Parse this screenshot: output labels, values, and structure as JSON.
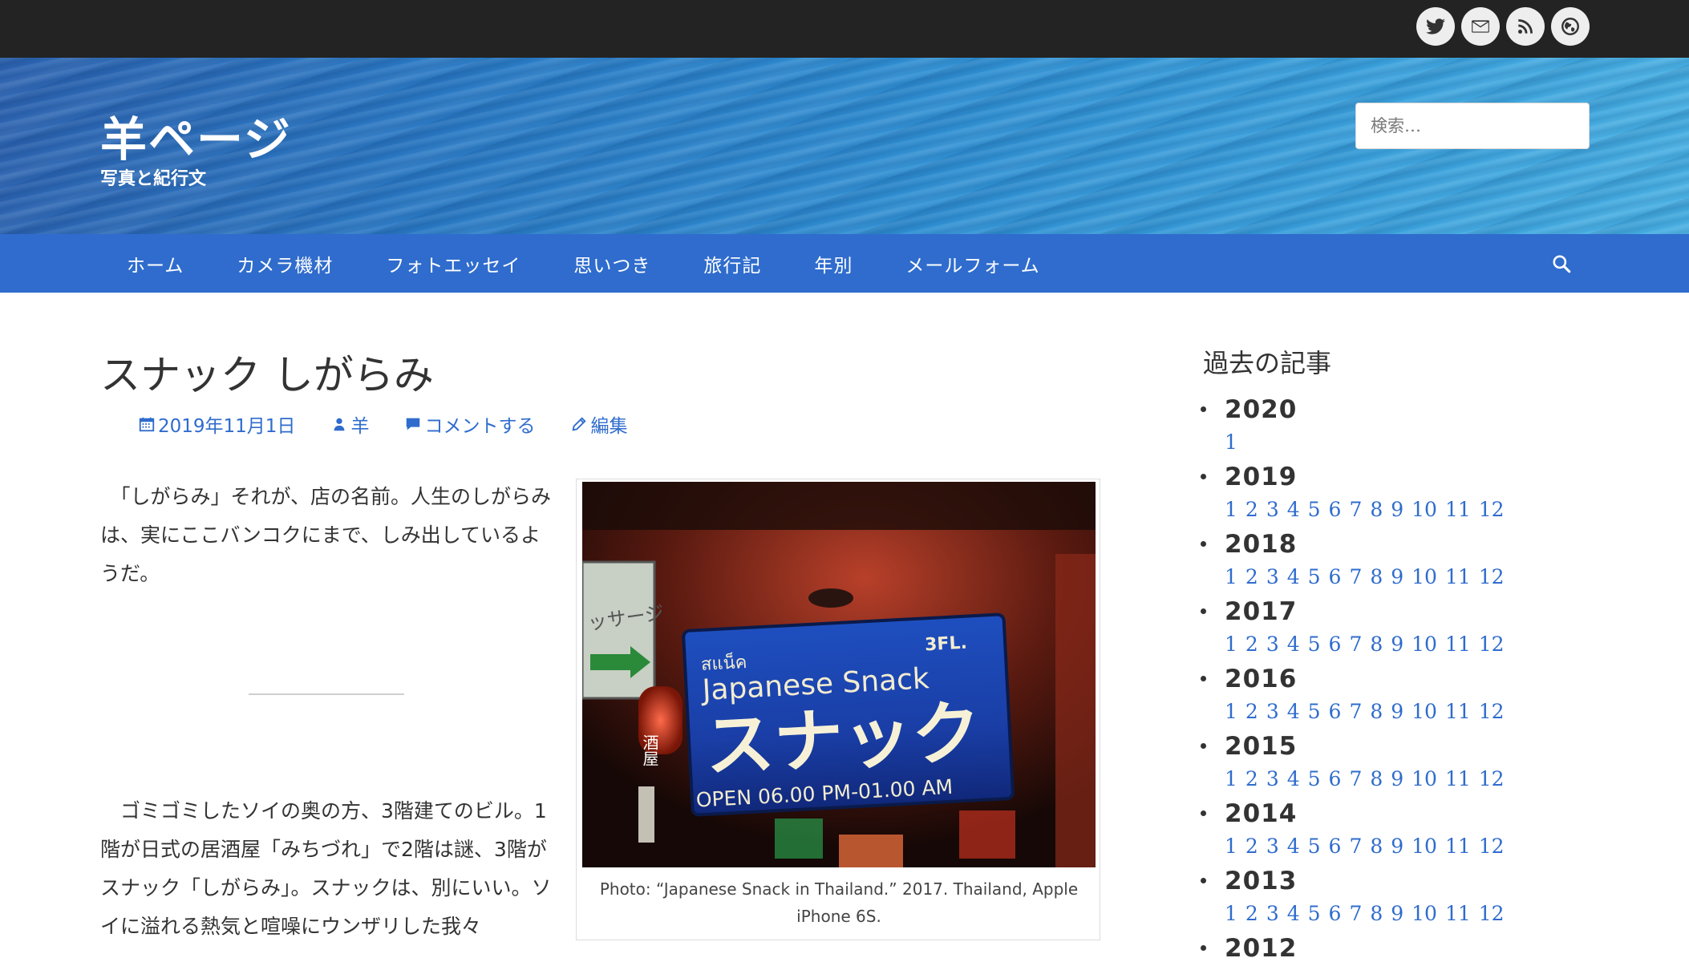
{
  "topbar": {
    "social": [
      {
        "icon": "twitter-icon"
      },
      {
        "icon": "mail-icon"
      },
      {
        "icon": "rss-icon"
      },
      {
        "icon": "globe-icon"
      }
    ]
  },
  "header": {
    "title": "羊ページ",
    "tagline": "写真と紀行文",
    "search_placeholder": "検索…"
  },
  "nav": {
    "items": [
      "ホーム",
      "カメラ機材",
      "フォトエッセイ",
      "思いつき",
      "旅行記",
      "年別",
      "メールフォーム"
    ]
  },
  "post": {
    "title": "スナック しがらみ",
    "date": "2019年11月1日",
    "author": "羊",
    "comment": "コメントする",
    "edit": "編集",
    "paragraph1": "　「しがらみ」それが、店の名前。人生のしがらみは、実にここバンコクにまで、しみ出しているようだ。",
    "paragraph2": "　ゴミゴミしたソイの奥の方、3階建てのビル。1階が日式の居酒屋「みちづれ」で2階は謎、3階がスナック「しがらみ」。スナックは、別にいい。ソイに溢れる熱気と喧噪にウンザリした我々",
    "caption": "Photo: “Japanese Snack in Thailand.” 2017. Thailand, Apple iPhone 6S.",
    "sign": {
      "floor": "3FL.",
      "thai": "สแน็ค",
      "english": "Japanese Snack",
      "katakana": "スナック",
      "hours": "OPEN 06.00 PM-01.00 AM",
      "left_sign": "ッサージ",
      "lantern": "酒屋"
    }
  },
  "sidebar": {
    "title": "過去の記事",
    "archives": [
      {
        "year": "2020",
        "months": [
          "1"
        ]
      },
      {
        "year": "2019",
        "months": [
          "1",
          "2",
          "3",
          "4",
          "5",
          "6",
          "7",
          "8",
          "9",
          "10",
          "11",
          "12"
        ]
      },
      {
        "year": "2018",
        "months": [
          "1",
          "2",
          "3",
          "4",
          "5",
          "6",
          "7",
          "8",
          "9",
          "10",
          "11",
          "12"
        ]
      },
      {
        "year": "2017",
        "months": [
          "1",
          "2",
          "3",
          "4",
          "5",
          "6",
          "7",
          "8",
          "9",
          "10",
          "11",
          "12"
        ]
      },
      {
        "year": "2016",
        "months": [
          "1",
          "2",
          "3",
          "4",
          "5",
          "6",
          "7",
          "8",
          "9",
          "10",
          "11",
          "12"
        ]
      },
      {
        "year": "2015",
        "months": [
          "1",
          "2",
          "3",
          "4",
          "5",
          "6",
          "7",
          "8",
          "9",
          "10",
          "11",
          "12"
        ]
      },
      {
        "year": "2014",
        "months": [
          "1",
          "2",
          "3",
          "4",
          "5",
          "6",
          "7",
          "8",
          "9",
          "10",
          "11",
          "12"
        ]
      },
      {
        "year": "2013",
        "months": [
          "1",
          "2",
          "3",
          "4",
          "5",
          "6",
          "7",
          "8",
          "9",
          "10",
          "11",
          "12"
        ]
      },
      {
        "year": "2012",
        "months": []
      }
    ]
  },
  "colors": {
    "topbar": "#232323",
    "nav": "#2f6ccd",
    "link": "#2f6ccd",
    "text": "#333333"
  }
}
